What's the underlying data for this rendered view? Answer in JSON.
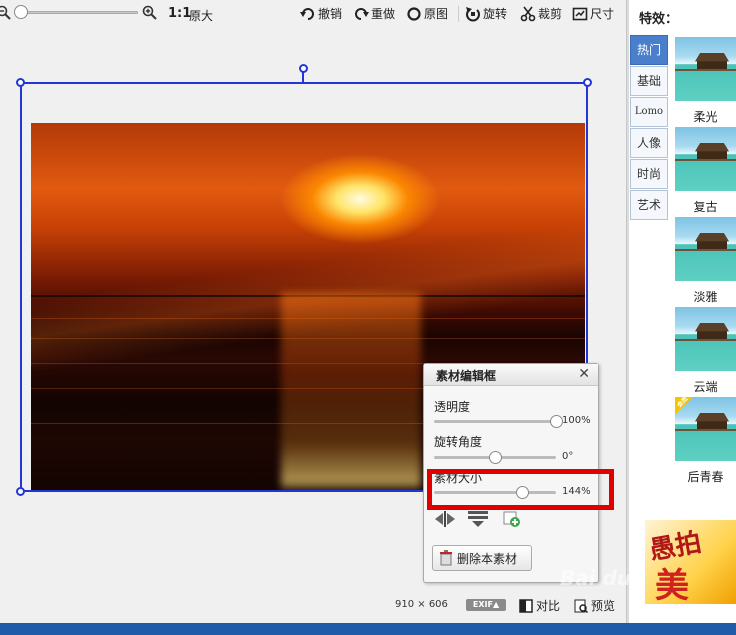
{
  "toolbar": {
    "ratio_label": "1:1",
    "original_size_label": "原大",
    "undo_label": "撤销",
    "redo_label": "重做",
    "original_label": "原图",
    "rotate_label": "旋转",
    "crop_label": "裁剪",
    "size_label": "尺寸"
  },
  "panel": {
    "title": "素材编辑框",
    "close_glyph": "✕",
    "opacity_label": "透明度",
    "opacity_value": "100%",
    "opacity_level": 1.0,
    "rotation_label": "旋转角度",
    "rotation_value": "0°",
    "rotation_level": 0.5,
    "size_label": "素材大小",
    "size_value": "144%",
    "size_level": 0.72,
    "delete_label": "删除本素材"
  },
  "status": {
    "dimensions": "910 × 606",
    "exif_label": "EXIF▲",
    "compare_label": "对比",
    "preview_label": "预览"
  },
  "effects": {
    "title": "特效：",
    "categories": [
      {
        "label": "热门",
        "active": true
      },
      {
        "label": "基础",
        "active": false
      },
      {
        "label": "Lomo",
        "active": false
      },
      {
        "label": "人像",
        "active": false
      },
      {
        "label": "时尚",
        "active": false
      },
      {
        "label": "艺术",
        "active": false
      }
    ],
    "items": [
      {
        "label": "柔光",
        "badge": ""
      },
      {
        "label": "复古",
        "badge": ""
      },
      {
        "label": "淡雅",
        "badge": ""
      },
      {
        "label": "云端",
        "badge": ""
      },
      {
        "label": "后青春",
        "badge": "会员"
      }
    ]
  },
  "ad": {
    "line1": "愚拍",
    "line2": "美"
  },
  "watermark": "Bai du",
  "colors": {
    "accent": "#2236d8",
    "highlight": "#e00000",
    "tab_active": "#4a7fcc"
  }
}
